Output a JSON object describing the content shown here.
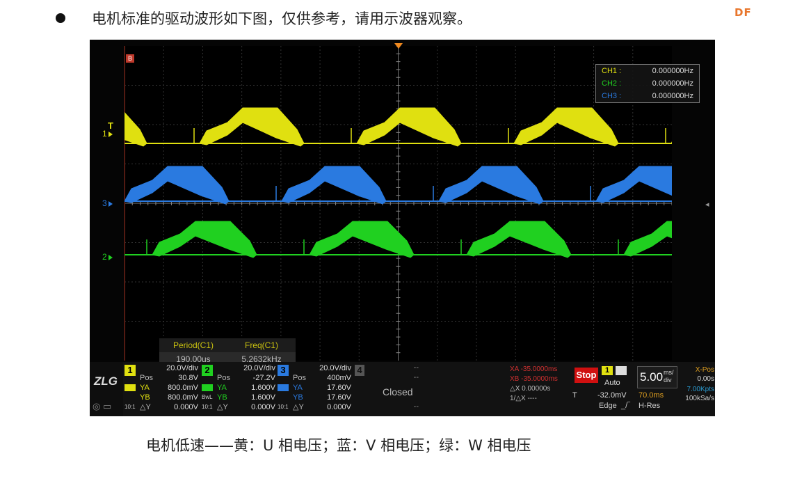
{
  "doc": {
    "instruction": "电机标准的驱动波形如下图，仅供参考，请用示波器观察。",
    "logo_text": "DF",
    "caption": "电机低速——黄：U 相电压；蓝：V 相电压；绿：W 相电压"
  },
  "scope": {
    "marker_b": "B",
    "channels": [
      {
        "id": "1",
        "label": "1",
        "color": "#e0e010",
        "pos_label": "T"
      },
      {
        "id": "3",
        "label": "3",
        "color": "#2a7ae0"
      },
      {
        "id": "2",
        "label": "2",
        "color": "#20d020"
      }
    ],
    "freq_box": [
      {
        "ch": "CH1 :",
        "value": "0.000000Hz",
        "color": "#e0e010"
      },
      {
        "ch": "CH2 :",
        "value": "0.000000Hz",
        "color": "#20d020"
      },
      {
        "ch": "CH3 :",
        "value": "0.000000Hz",
        "color": "#2a7ae0"
      }
    ],
    "measure": {
      "h1": "Period(C1)",
      "h2": "Freq(C1)",
      "v1": "190.00us",
      "v2": "5.2632kHz"
    },
    "bottom": {
      "ch1": {
        "num": "1",
        "scale": "20.0V/div",
        "pos_k": "Pos",
        "pos_v": "30.8V",
        "ya_k": "YA",
        "ya_v": "800.0mV",
        "yb_k": "YB",
        "yb_v": "800.0mV",
        "dy_k": "△Y",
        "dy_v": "0.000V",
        "coupling": "10:1"
      },
      "ch2": {
        "num": "2",
        "scale": "20.0V/div",
        "pos_k": "Pos",
        "pos_v": "-27.2V",
        "ya_k": "YA",
        "ya_v": "1.600V",
        "yb_k": "YB",
        "yb_v": "1.600V",
        "dy_k": "△Y",
        "dy_v": "0.000V",
        "coupling": "10:1",
        "bw": "BwL"
      },
      "ch3": {
        "num": "3",
        "scale": "20.0V/div",
        "pos_k": "Pos",
        "pos_v": "400mV",
        "ya_k": "YA",
        "ya_v": "17.60V",
        "yb_k": "YB",
        "yb_v": "17.60V",
        "dy_k": "△Y",
        "dy_v": "0.000V",
        "coupling": "10:1"
      },
      "ch4": {
        "num": "4",
        "dash1": "--",
        "dash2": "--",
        "dash3": "--",
        "closed": "Closed"
      },
      "cursor": {
        "xa": "XA -35.0000ms",
        "xb": "XB -35.0000ms",
        "dx": "△X   0.00000s",
        "inv": "1/△X     ----"
      },
      "stop": "Stop",
      "trigger": {
        "ch": "1",
        "mode": "Auto",
        "t_label": "T",
        "t_value": "-32.0mV",
        "type": "Edge"
      },
      "timebase": {
        "value": "5.00",
        "unit_top": "ms/",
        "unit_bot": "div",
        "delay": "70.0ms",
        "res": "H-Res"
      },
      "xpos": {
        "label": "X-Pos",
        "value": "0.00s",
        "pts": "7.00Kpts",
        "rate": "100kSa/s"
      }
    }
  }
}
